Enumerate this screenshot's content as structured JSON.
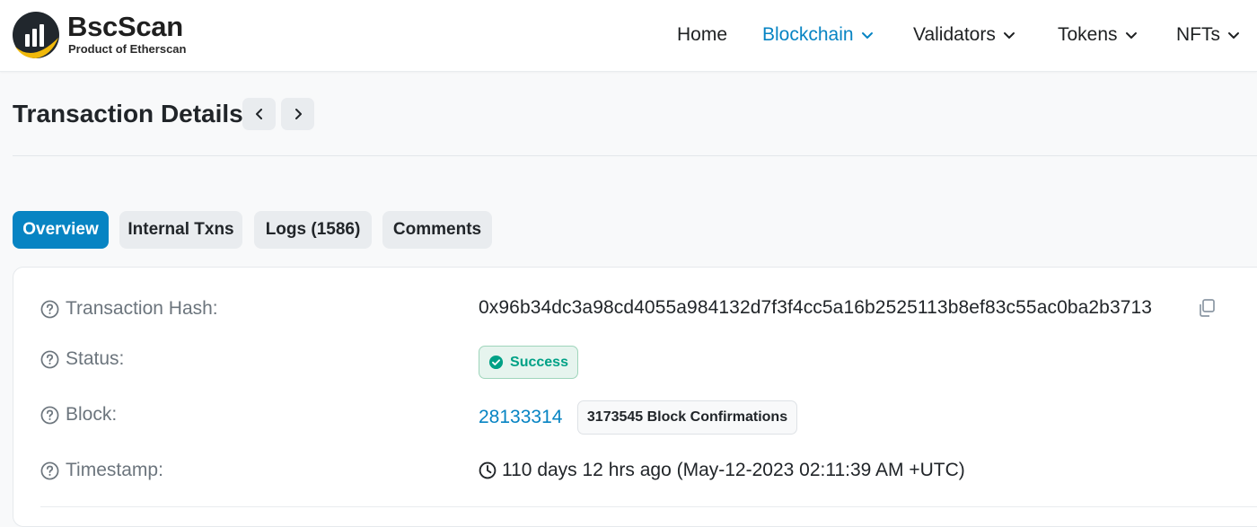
{
  "brand": {
    "name": "BscScan",
    "tagline": "Product of Etherscan"
  },
  "nav": {
    "items": [
      {
        "label": "Home",
        "dropdown": false,
        "active": false
      },
      {
        "label": "Blockchain",
        "dropdown": true,
        "active": true
      },
      {
        "label": "Validators",
        "dropdown": true,
        "active": false
      },
      {
        "label": "Tokens",
        "dropdown": true,
        "active": false
      },
      {
        "label": "NFTs",
        "dropdown": true,
        "active": false
      }
    ]
  },
  "page": {
    "title": "Transaction Details"
  },
  "tabs": [
    {
      "label": "Overview",
      "active": true
    },
    {
      "label": "Internal Txns",
      "active": false
    },
    {
      "label": "Logs (1586)",
      "active": false
    },
    {
      "label": "Comments",
      "active": false
    }
  ],
  "details": {
    "hash": {
      "label": "Transaction Hash:",
      "value": "0x96b34dc3a98cd4055a984132d7f3f4cc5a16b2525113b8ef83c55ac0ba2b3713"
    },
    "status": {
      "label": "Status:",
      "value": "Success"
    },
    "block": {
      "label": "Block:",
      "value": "28133314",
      "confirmations": "3173545 Block Confirmations"
    },
    "timestamp": {
      "label": "Timestamp:",
      "value": "110 days 12 hrs ago (May-12-2023 02:11:39 AM +UTC)"
    }
  },
  "colors": {
    "accent": "#0784c3",
    "success": "#00a186",
    "logo_dark": "#21272d",
    "logo_gold": "#f0b90b"
  },
  "icons": {
    "logo": "bscscan-logo-icon",
    "prev": "chevron-left-icon",
    "next": "chevron-right-icon",
    "help": "question-circle-icon",
    "copy": "copy-icon",
    "success": "check-circle-icon",
    "clock": "clock-icon"
  }
}
